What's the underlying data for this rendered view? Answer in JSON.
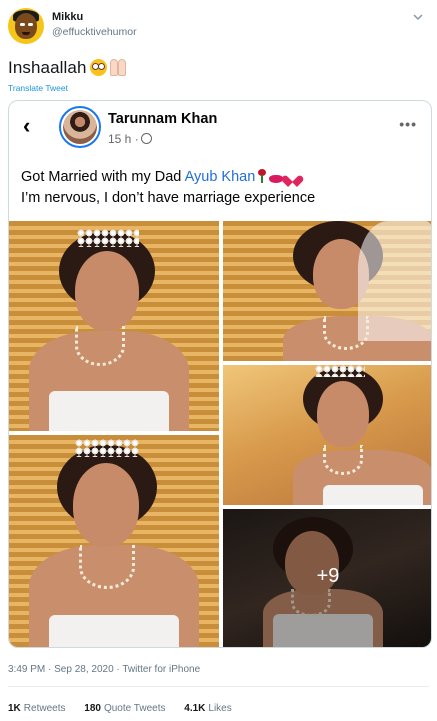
{
  "tweet": {
    "author_name": "Mikku",
    "author_handle": "@effucktivehumor",
    "text": "Inshaallah",
    "emoji": [
      "flushed-face",
      "folded-hands"
    ],
    "translate_label": "Translate Tweet",
    "timestamp": "3:49 PM · Sep 28, 2020 · Twitter for iPhone",
    "stats": {
      "retweets_count": "1K",
      "retweets_label": "Retweets",
      "quote_count": "180",
      "quote_label": "Quote Tweets",
      "likes_count": "4.1K",
      "likes_label": "Likes"
    }
  },
  "embedded_post": {
    "back_icon": "back-arrow-icon",
    "poster_name": "Tarunnam Khan",
    "post_time": "15 h ·",
    "privacy_icon": "globe-icon",
    "more_icon": "more-options-icon",
    "text_line1_prefix": "Got Married with my Dad",
    "mention": "Ayub Khan",
    "emoji": [
      "rose",
      "kiss-mark",
      "red-heart"
    ],
    "text_line2": "I’m nervous, I don’t have marriage experience",
    "photos_more_count": "+9"
  }
}
